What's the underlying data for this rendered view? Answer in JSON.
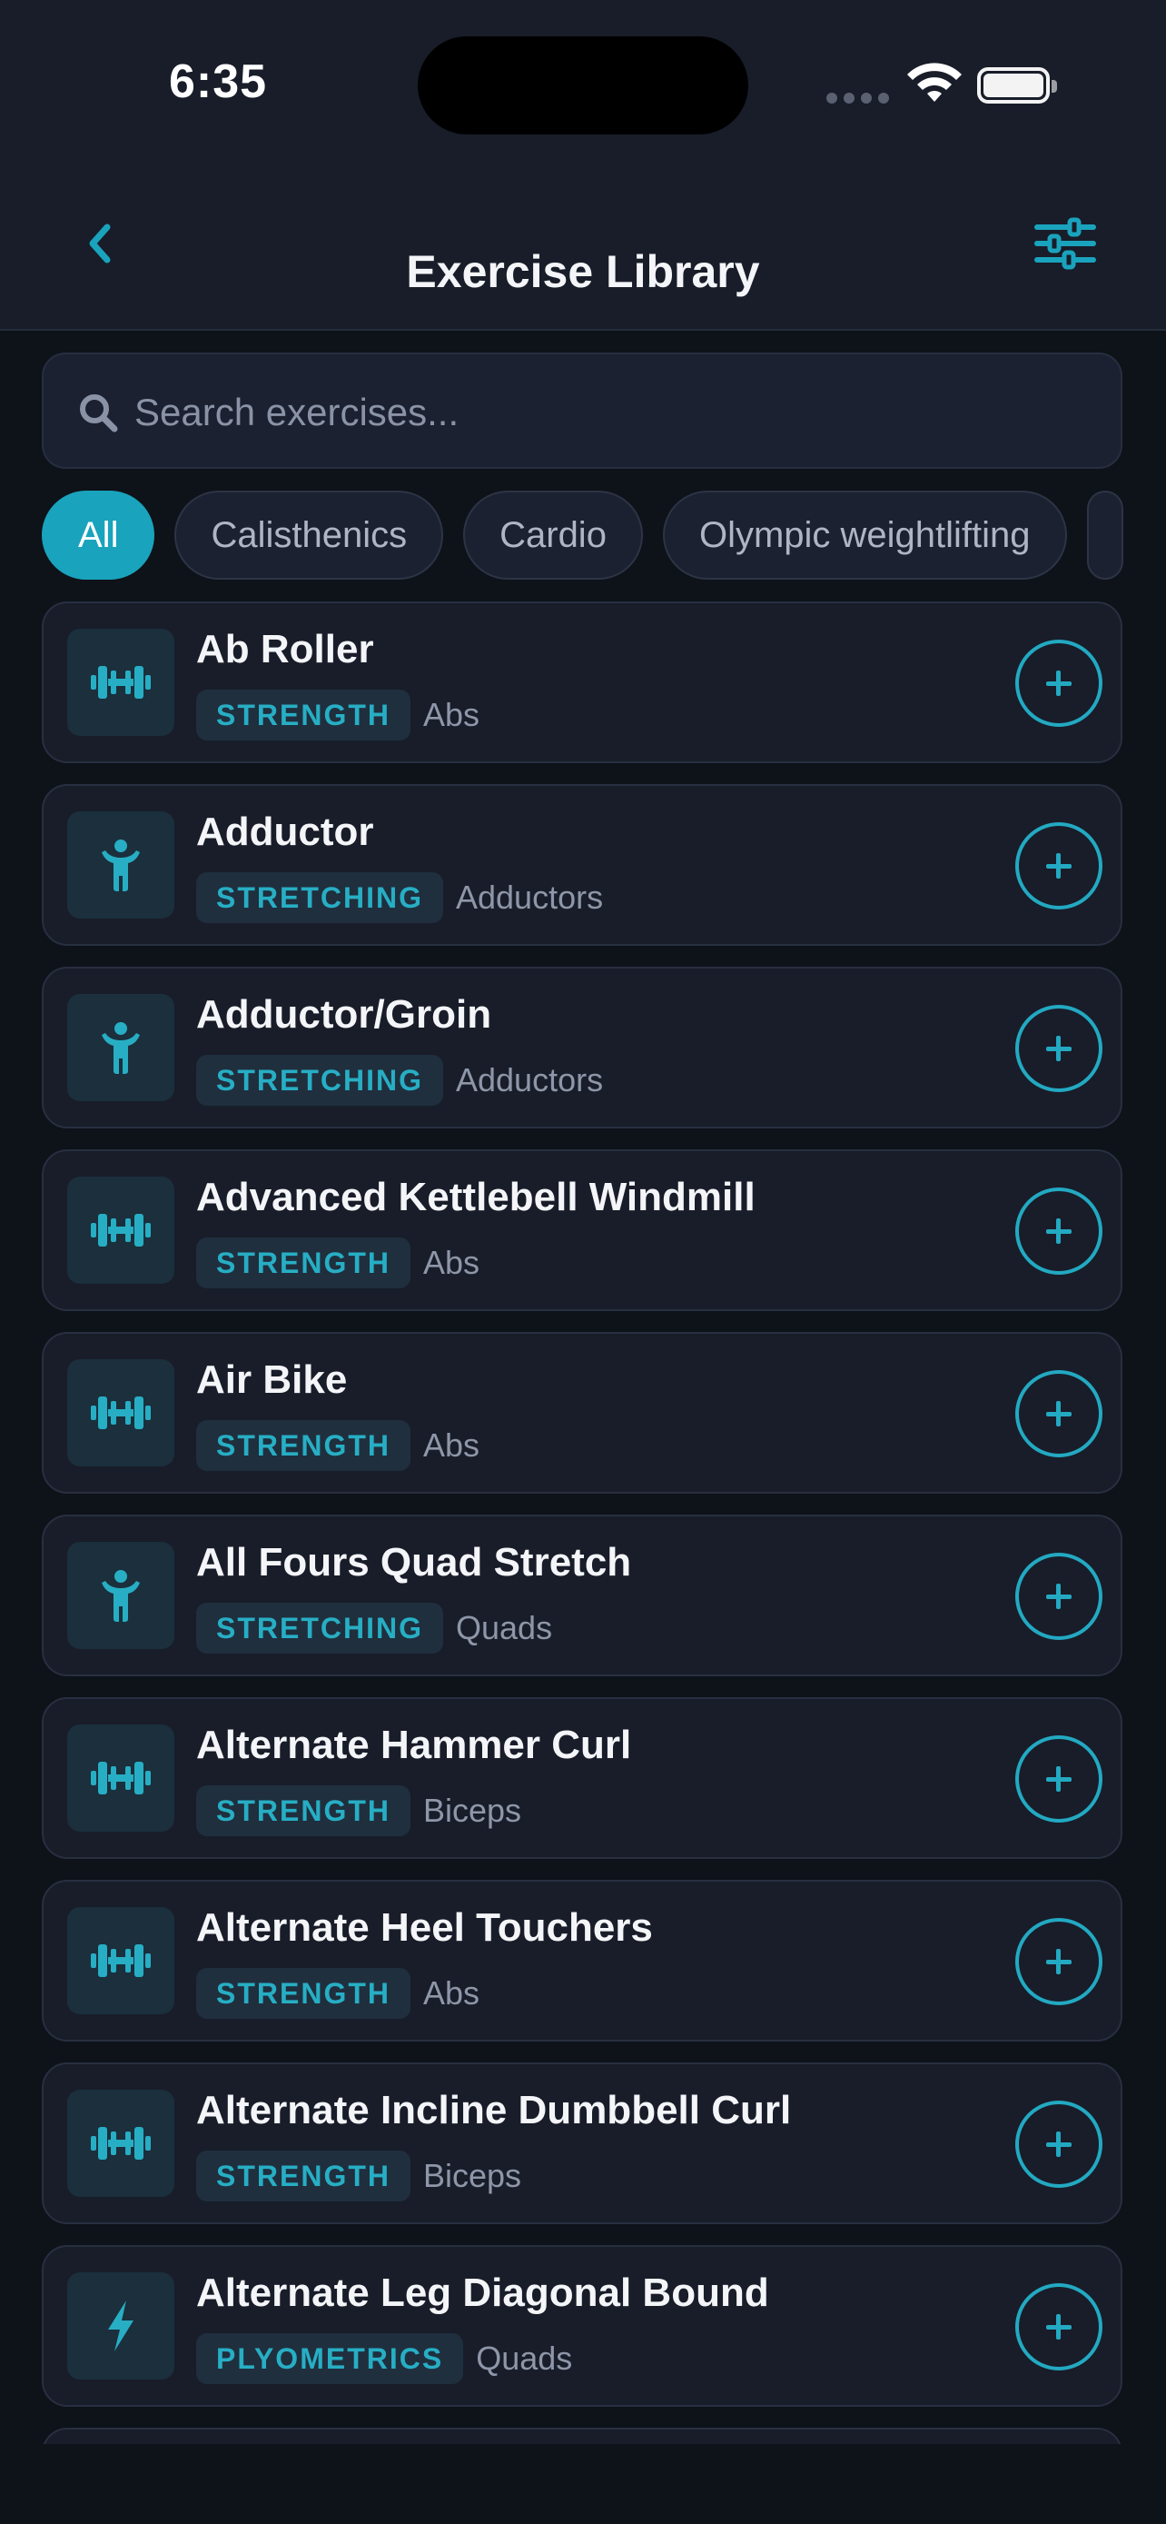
{
  "status_bar": {
    "time": "6:35"
  },
  "header": {
    "title": "Exercise Library"
  },
  "search": {
    "placeholder": "Search exercises..."
  },
  "filters": {
    "chips": [
      "All",
      "Calisthenics",
      "Cardio",
      "Olympic weightlifting"
    ],
    "selected": "All"
  },
  "exercises": [
    {
      "name": "Ab Roller",
      "category": "STRENGTH",
      "muscle": "Abs",
      "icon": "dumbbell-icon"
    },
    {
      "name": "Adductor",
      "category": "STRETCHING",
      "muscle": "Adductors",
      "icon": "person-icon"
    },
    {
      "name": "Adductor/Groin",
      "category": "STRETCHING",
      "muscle": "Adductors",
      "icon": "person-icon"
    },
    {
      "name": "Advanced Kettlebell Windmill",
      "category": "STRENGTH",
      "muscle": "Abs",
      "icon": "dumbbell-icon"
    },
    {
      "name": "Air Bike",
      "category": "STRENGTH",
      "muscle": "Abs",
      "icon": "dumbbell-icon"
    },
    {
      "name": "All Fours Quad Stretch",
      "category": "STRETCHING",
      "muscle": "Quads",
      "icon": "person-icon"
    },
    {
      "name": "Alternate Hammer Curl",
      "category": "STRENGTH",
      "muscle": "Biceps",
      "icon": "dumbbell-icon"
    },
    {
      "name": "Alternate Heel Touchers",
      "category": "STRENGTH",
      "muscle": "Abs",
      "icon": "dumbbell-icon"
    },
    {
      "name": "Alternate Incline Dumbbell Curl",
      "category": "STRENGTH",
      "muscle": "Biceps",
      "icon": "dumbbell-icon"
    },
    {
      "name": "Alternate Leg Diagonal Bound",
      "category": "PLYOMETRICS",
      "muscle": "Quads",
      "icon": "bolt-icon"
    }
  ],
  "colors": {
    "accent": "#1aa3bd",
    "background": "#0e1219",
    "card": "#181d29"
  }
}
